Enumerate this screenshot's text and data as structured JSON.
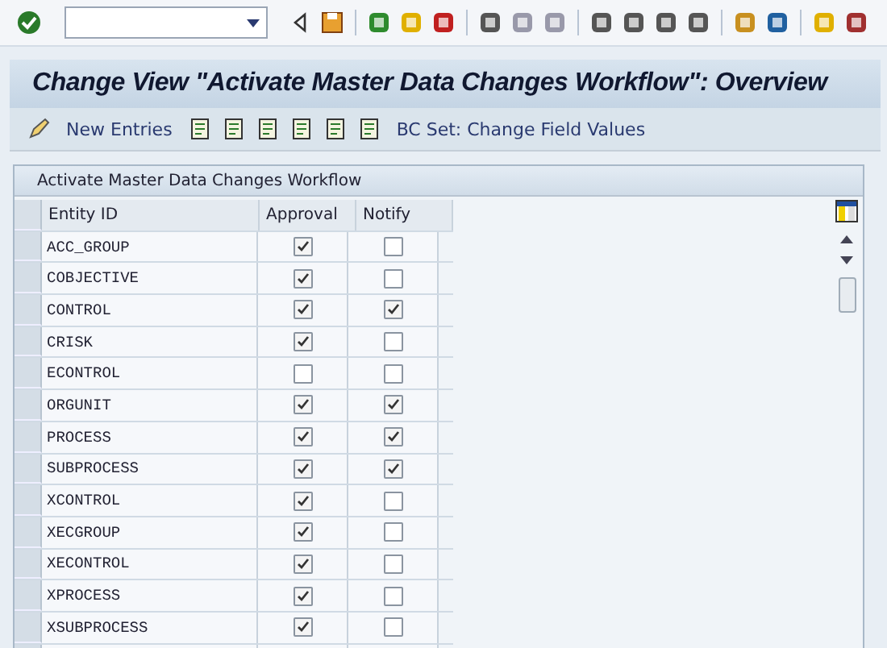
{
  "title": "Change View \"Activate Master Data Changes Workflow\": Overview",
  "app_toolbar": {
    "new_entries": "New Entries",
    "bc_set": "BC Set: Change Field Values"
  },
  "table": {
    "title": "Activate Master Data Changes Workflow",
    "columns": [
      "Entity ID",
      "Approval",
      "Notify"
    ],
    "rows": [
      {
        "entity": "ACC_GROUP",
        "approval": true,
        "notify": false
      },
      {
        "entity": "COBJECTIVE",
        "approval": true,
        "notify": false
      },
      {
        "entity": "CONTROL",
        "approval": true,
        "notify": true
      },
      {
        "entity": "CRISK",
        "approval": true,
        "notify": false
      },
      {
        "entity": "ECONTROL",
        "approval": false,
        "notify": false
      },
      {
        "entity": "ORGUNIT",
        "approval": true,
        "notify": true
      },
      {
        "entity": "PROCESS",
        "approval": true,
        "notify": true
      },
      {
        "entity": "SUBPROCESS",
        "approval": true,
        "notify": true
      },
      {
        "entity": "XCONTROL",
        "approval": true,
        "notify": false
      },
      {
        "entity": "XECGROUP",
        "approval": true,
        "notify": false
      },
      {
        "entity": "XECONTROL",
        "approval": true,
        "notify": false
      },
      {
        "entity": "XPROCESS",
        "approval": true,
        "notify": false
      },
      {
        "entity": "XSUBPROCESS",
        "approval": true,
        "notify": false
      }
    ]
  }
}
